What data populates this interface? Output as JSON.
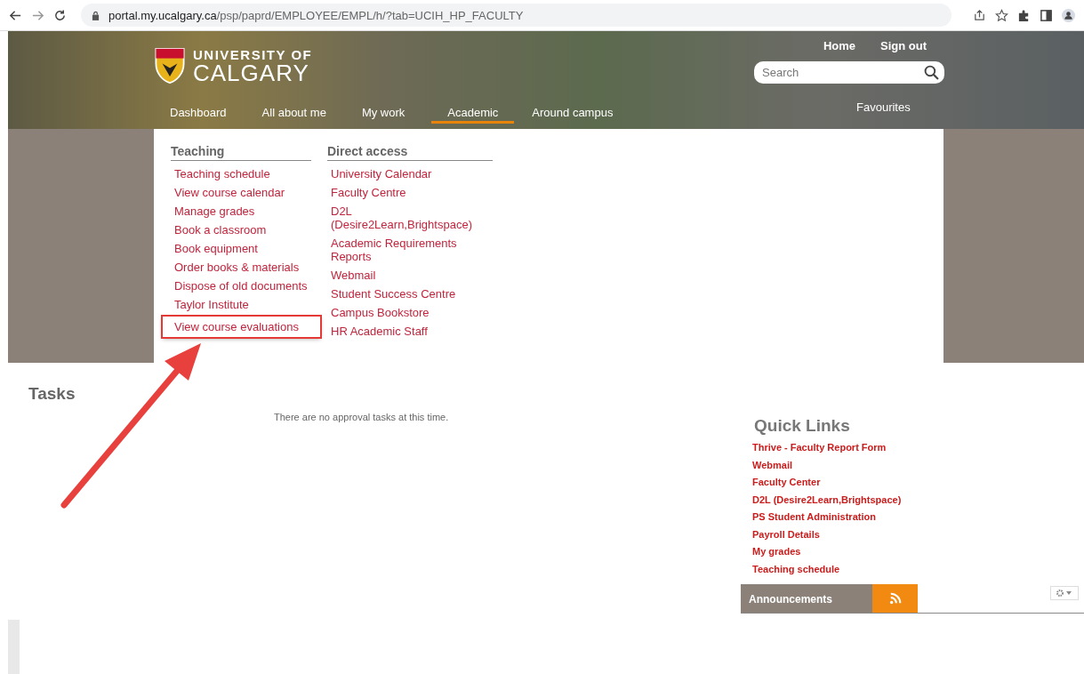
{
  "browser": {
    "url_host": "portal.my.ucalgary.ca",
    "url_path": "/psp/paprd/EMPLOYEE/EMPL/h/?tab=UCIH_HP_FACULTY"
  },
  "header": {
    "logo_line1": "UNIVERSITY OF",
    "logo_line2": "CALGARY",
    "top_links": [
      "Home",
      "Sign out"
    ],
    "search": {
      "placeholder": "Search"
    },
    "tabs": [
      {
        "label": "Dashboard",
        "selected": false
      },
      {
        "label": "All about me",
        "selected": false
      },
      {
        "label": "My work",
        "selected": false
      },
      {
        "label": "Academic",
        "selected": true
      },
      {
        "label": "Around campus",
        "selected": false
      }
    ],
    "favourites": "Favourites"
  },
  "menu": {
    "columns": [
      {
        "heading": "Teaching",
        "items": [
          {
            "label": "Teaching schedule",
            "highlighted": false
          },
          {
            "label": "View course calendar",
            "highlighted": false
          },
          {
            "label": "Manage grades",
            "highlighted": false
          },
          {
            "label": "Book a classroom",
            "highlighted": false
          },
          {
            "label": "Book equipment",
            "highlighted": false
          },
          {
            "label": "Order books & materials",
            "highlighted": false
          },
          {
            "label": "Dispose of old documents",
            "highlighted": false
          },
          {
            "label": "Taylor Institute",
            "highlighted": false
          },
          {
            "label": "View course evaluations",
            "highlighted": true
          }
        ]
      },
      {
        "heading": "Direct access",
        "items": [
          {
            "label": "University Calendar",
            "highlighted": false
          },
          {
            "label": "Faculty Centre",
            "highlighted": false
          },
          {
            "label": "D2L (Desire2Learn,Brightspace)",
            "highlighted": false
          },
          {
            "label": "Academic Requirements Reports",
            "highlighted": false
          },
          {
            "label": "Webmail",
            "highlighted": false
          },
          {
            "label": "Student Success Centre",
            "highlighted": false
          },
          {
            "label": "Campus Bookstore",
            "highlighted": false
          },
          {
            "label": "HR Academic Staff",
            "highlighted": false
          }
        ]
      }
    ]
  },
  "tasks": {
    "title": "Tasks",
    "message": "There are no approval tasks at this time."
  },
  "quick_links": {
    "title": "Quick Links",
    "items": [
      "Thrive - Faculty Report Form",
      "Webmail",
      "Faculty Center",
      "D2L (Desire2Learn,Brightspace)",
      "PS Student Administration",
      "Payroll Details",
      "My grades",
      "Teaching schedule"
    ]
  },
  "announcements": {
    "title": "Announcements"
  }
}
